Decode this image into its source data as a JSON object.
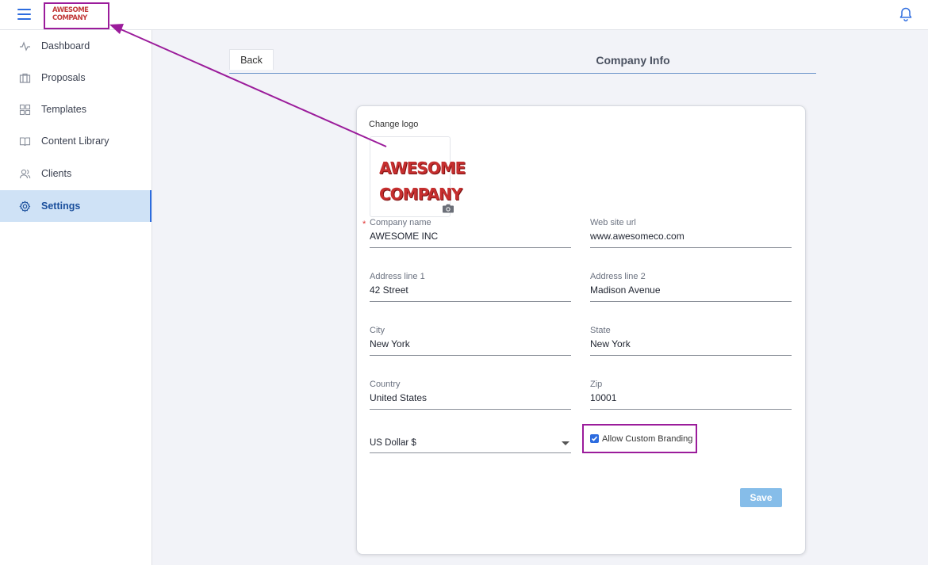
{
  "header": {
    "logo_line1": "AWESOME",
    "logo_line2": "COMPANY",
    "menu_icon": "hamburger-icon",
    "bell_icon": "bell-icon"
  },
  "sidebar": {
    "items": [
      {
        "label": "Dashboard",
        "icon": "activity-icon"
      },
      {
        "label": "Proposals",
        "icon": "briefcase-icon"
      },
      {
        "label": "Templates",
        "icon": "grid-icon"
      },
      {
        "label": "Content Library",
        "icon": "book-icon"
      },
      {
        "label": "Clients",
        "icon": "users-icon"
      },
      {
        "label": "Settings",
        "icon": "gear-icon",
        "active": true
      }
    ]
  },
  "page": {
    "back_label": "Back",
    "title": "Company Info"
  },
  "form": {
    "change_logo_label": "Change logo",
    "logo_line1": "AWESOME",
    "logo_line2": "COMPANY",
    "required_mark": "*",
    "company_name": {
      "label": "Company name",
      "value": "AWESOME INC"
    },
    "website": {
      "label": "Web site url",
      "value": "www.awesomeco.com"
    },
    "address1": {
      "label": "Address line 1",
      "value": "42 Street"
    },
    "address2": {
      "label": "Address line 2",
      "value": "Madison Avenue"
    },
    "city": {
      "label": "City",
      "value": "New York"
    },
    "state": {
      "label": "State",
      "value": "New York"
    },
    "country": {
      "label": "Country",
      "value": "United States"
    },
    "zip": {
      "label": "Zip",
      "value": "10001"
    },
    "currency": {
      "value": "US Dollar $"
    },
    "custom_branding": {
      "label": "Allow Custom Branding",
      "checked": true
    },
    "save_label": "Save"
  },
  "colors": {
    "accent": "#2d6cdf",
    "annotation": "#9b1c9b",
    "save_button": "#86bde9",
    "logo_red": "#c23b3b"
  }
}
